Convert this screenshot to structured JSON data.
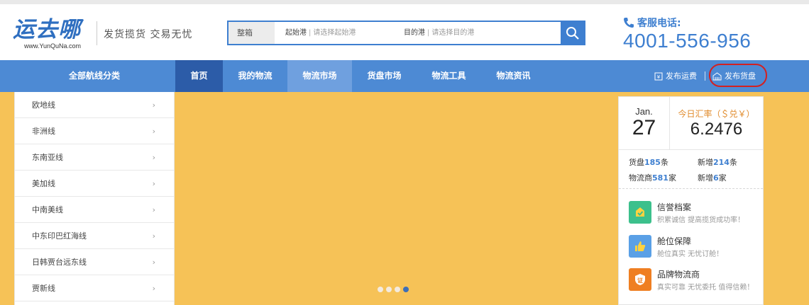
{
  "header": {
    "logo_text": "运去哪",
    "logo_url": "www.YunQuNa.com",
    "slogan": "发货揽货 交易无忧",
    "hotline_label": "客服电话:",
    "hotline_number": "4001-556-956"
  },
  "search": {
    "type_label": "整箱",
    "origin_label": "起始港",
    "origin_placeholder": "请选择起始港",
    "dest_label": "目的港",
    "dest_placeholder": "请选择目的港"
  },
  "nav": {
    "category_label": "全部航线分类",
    "items": [
      {
        "label": "首页"
      },
      {
        "label": "我的物流"
      },
      {
        "label": "物流市场"
      },
      {
        "label": "货盘市场"
      },
      {
        "label": "物流工具"
      },
      {
        "label": "物流资讯"
      }
    ],
    "publish_freight": "发布运费",
    "publish_cargo": "发布货盘"
  },
  "sidebar": {
    "items": [
      {
        "label": "欧地线"
      },
      {
        "label": "非洲线"
      },
      {
        "label": "东南亚线"
      },
      {
        "label": "美加线"
      },
      {
        "label": "中南美线"
      },
      {
        "label": "中东印巴红海线"
      },
      {
        "label": "日韩贾台远东线"
      },
      {
        "label": "贾新线"
      }
    ],
    "chevron": "›"
  },
  "carousel": {
    "dots": 4,
    "active_index": 3
  },
  "panel": {
    "month": "Jan.",
    "day": "27",
    "rate_label": "今日汇率（＄兑￥）",
    "rate_value": "6.2476",
    "stats": {
      "cargo_prefix": "货盘",
      "cargo_count": "185",
      "cargo_suffix": "条",
      "new1_prefix": "新增",
      "new1_count": "214",
      "new1_suffix": "条",
      "logistics_prefix": "物流商",
      "logistics_count": "581",
      "logistics_suffix": "家",
      "new2_prefix": "新增",
      "new2_count": "6",
      "new2_suffix": "家"
    },
    "features": [
      {
        "title": "信誉档案",
        "sub": "积累诚信 提高揽货成功率！",
        "color": "#3cc08c"
      },
      {
        "title": "舱位保障",
        "sub": "舱位真实 无忧订舱！",
        "color": "#5aa0e6"
      },
      {
        "title": "品牌物流商",
        "sub": "真实可靠 无忧委托 值得信赖！",
        "color": "#ef7f22"
      }
    ]
  },
  "colors": {
    "brand_blue": "#4d8ad4",
    "nav_home": "#2c5ca8",
    "banner": "#f6c257",
    "highlight_circle": "#d42020"
  }
}
